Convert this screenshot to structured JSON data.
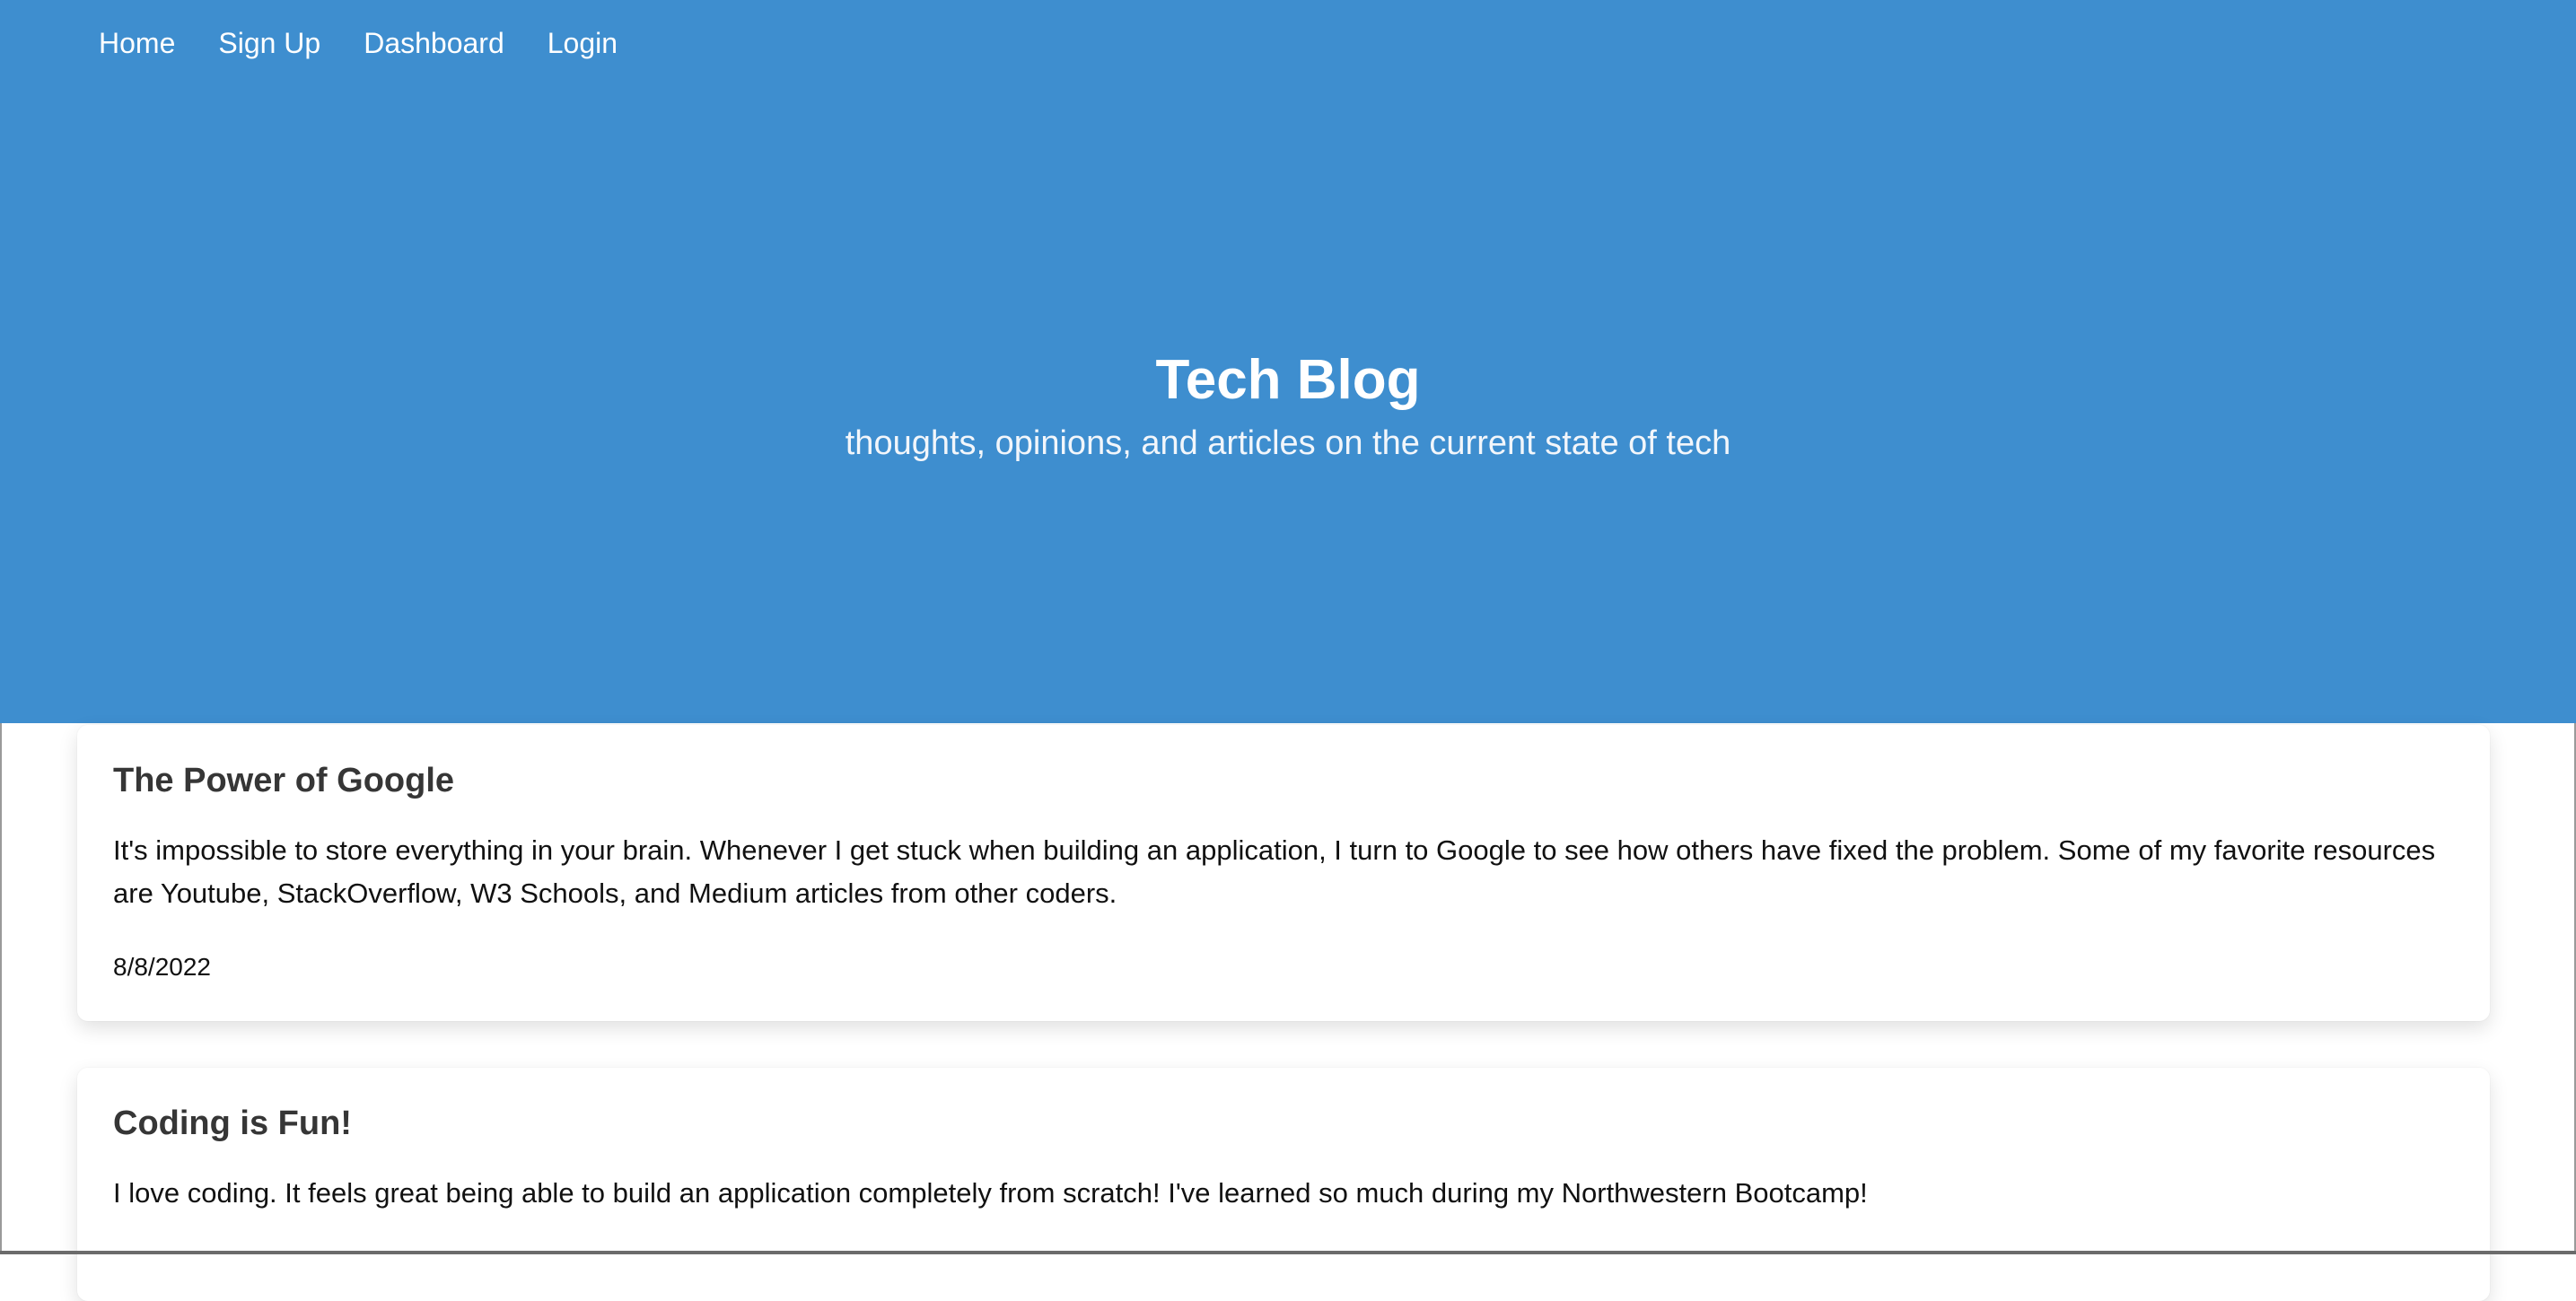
{
  "nav": {
    "items": [
      {
        "label": "Home"
      },
      {
        "label": "Sign Up"
      },
      {
        "label": "Dashboard"
      },
      {
        "label": "Login"
      }
    ]
  },
  "hero": {
    "title": "Tech Blog",
    "subtitle": "thoughts, opinions, and articles on the current state of tech"
  },
  "posts": [
    {
      "title": "The Power of Google",
      "body": "It's impossible to store everything in your brain. Whenever I get stuck when building an application, I turn to Google to see how others have fixed the problem. Some of my favorite resources are Youtube, StackOverflow, W3 Schools, and Medium articles from other coders.",
      "date": "8/8/2022"
    },
    {
      "title": "Coding is Fun!",
      "body": "I love coding. It feels great being able to build an application completely from scratch! I've learned so much during my Northwestern Bootcamp!"
    }
  ],
  "colors": {
    "hero_background": "#3e8ecf",
    "hero_text": "#ffffff",
    "card_background": "#ffffff"
  }
}
